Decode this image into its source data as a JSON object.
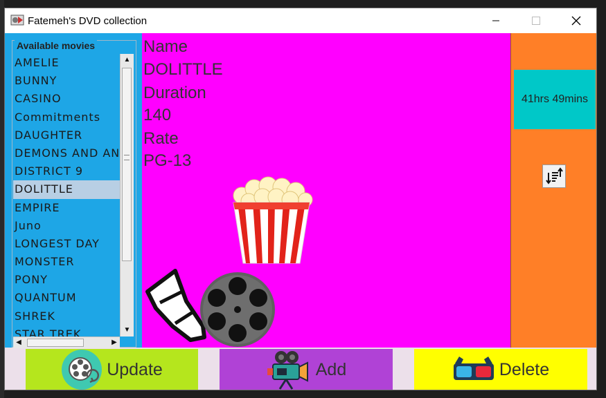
{
  "window": {
    "title": "Fatemeh's DVD collection"
  },
  "list": {
    "caption": "Available movies",
    "items": [
      "AMELIE",
      "BUNNY",
      "CASINO",
      "Commitments",
      "DAUGHTER",
      "DEMONS AND ANG",
      "DISTRICT 9",
      "DOLITTLE",
      "EMPIRE",
      "Juno",
      "LONGEST DAY",
      "MONSTER",
      "PONY",
      "QUANTUM",
      "SHREK",
      "STAR TREK"
    ],
    "selected_index": 7
  },
  "details": {
    "name_label": "Name",
    "name_value": "DOLITTLE",
    "duration_label": "Duration",
    "duration_value": "140",
    "rate_label": "Rate",
    "rate_value": "PG-13"
  },
  "summary": {
    "total_duration": "41hrs 49mins"
  },
  "buttons": {
    "update": "Update",
    "add": "Add",
    "delete": "Delete"
  },
  "colors": {
    "left_panel": "#1ea6e6",
    "main_panel": "#ff00ff",
    "right_panel": "#ff7f27",
    "total_box": "#00c8c8",
    "update_button": "#b5e61d",
    "add_button": "#b042d6",
    "delete_button": "#ffff00"
  },
  "icons": {
    "app": "dvd-app-icon",
    "minimize": "minimize-icon",
    "maximize": "maximize-icon",
    "close": "close-icon",
    "sort": "sort-icon",
    "update": "film-reel-refresh-icon",
    "add": "movie-camera-icon",
    "delete": "3d-glasses-icon"
  }
}
